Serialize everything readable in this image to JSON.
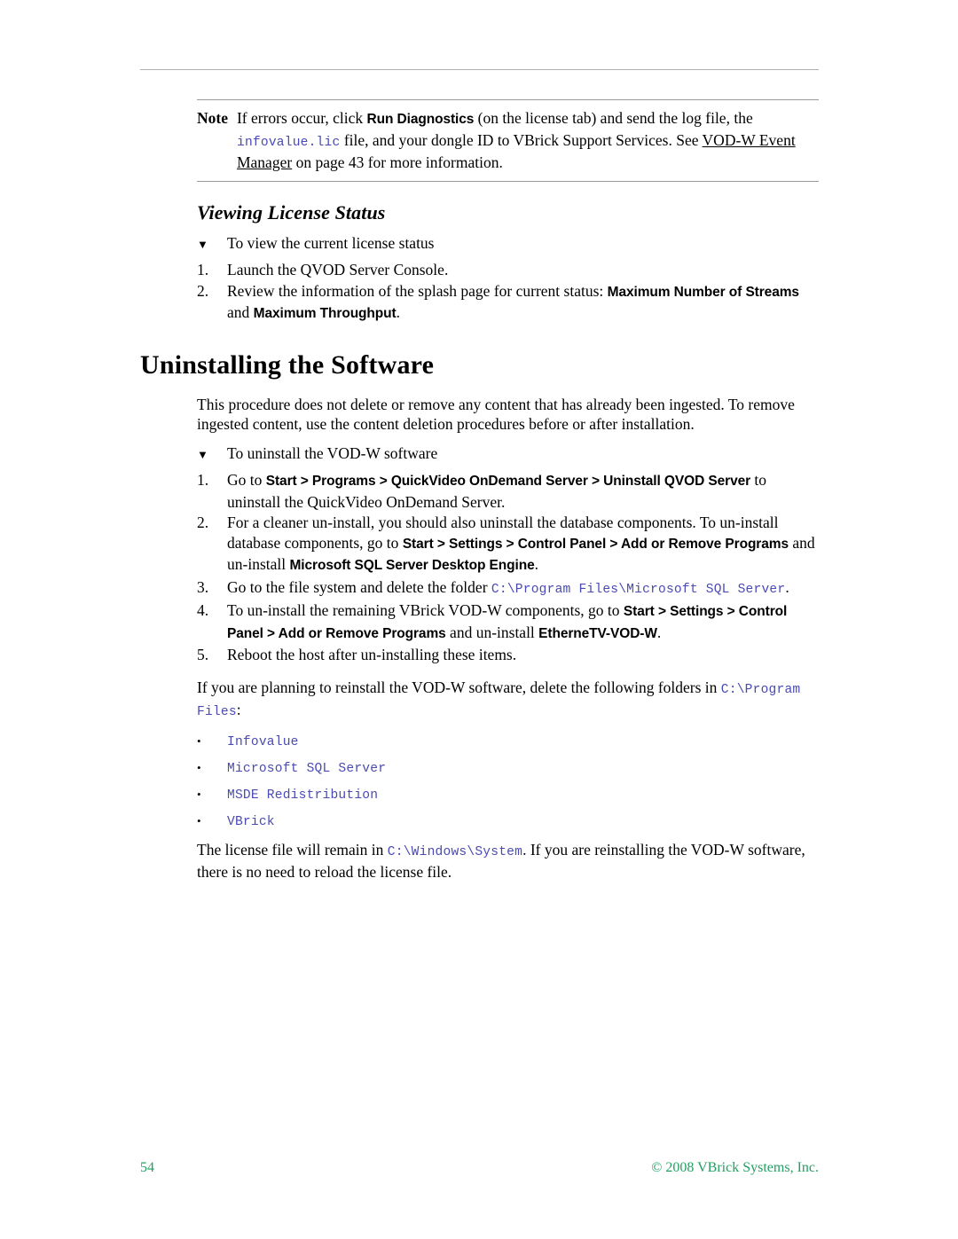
{
  "document": {
    "note": {
      "label": "Note",
      "text_1": "If errors occur, click ",
      "bold_1": "Run Diagnostics",
      "text_2": " (on the license tab) and send the log file, the ",
      "code_1": "infovalue.lic",
      "text_3": " file, and your dongle ID to VBrick Support Services. See ",
      "xref": "VOD-W Event Manager",
      "text_4": " on page 43 for more information."
    },
    "section_license": {
      "heading": "Viewing License Status",
      "procedure_title": "To view the current license status",
      "triangle_marker": "▼",
      "steps": [
        {
          "num": "1.",
          "text_1": "Launch the QVOD Server Console."
        },
        {
          "num": "2.",
          "text_1": "Review the information of the splash page for current status: ",
          "bold_1": "Maximum Number of Streams",
          "text_2": " and ",
          "bold_2": "Maximum Throughput",
          "text_3": "."
        }
      ]
    },
    "section_uninstall": {
      "heading": "Uninstalling the Software",
      "intro": "This procedure does not delete or remove any content that has already been ingested. To remove ingested content, use the content deletion procedures before or after installation.",
      "procedure_title": "To uninstall the VOD-W software",
      "triangle_marker": "▼",
      "steps": [
        {
          "num": "1.",
          "text_1": "Go to ",
          "bold_1": "Start > Programs > QuickVideo OnDemand Server > Uninstall QVOD Server",
          "text_2": " to uninstall the QuickVideo OnDemand Server."
        },
        {
          "num": "2.",
          "text_1": "For a cleaner un-install, you should also uninstall the database components. To un-install database components, go to ",
          "bold_1": "Start > Settings > Control Panel > Add or Remove Programs",
          "text_2": " and un-install ",
          "bold_2": "Microsoft SQL Server Desktop Engine",
          "text_3": "."
        },
        {
          "num": "3.",
          "text_1": "Go to the file system and delete the folder ",
          "code_1": "C:\\Program Files\\Microsoft SQL Server",
          "text_2": "."
        },
        {
          "num": "4.",
          "text_1": "To un-install the remaining VBrick VOD-W components, go to ",
          "bold_1": "Start > Settings > Control Panel > Add or Remove Programs",
          "text_2": " and un-install ",
          "bold_2": "EtherneTV-VOD-W",
          "text_3": "."
        },
        {
          "num": "5.",
          "text_1": "Reboot the host after un-installing these items."
        }
      ],
      "reinstall_para": {
        "text_1": "If you are planning to reinstall the VOD-W software, delete the following folders in ",
        "code_1": "C:\\Program Files",
        "text_2": ":"
      },
      "folder_bullet": "•",
      "folders": [
        "Infovalue",
        "Microsoft SQL Server",
        "MSDE Redistribution",
        "VBrick"
      ],
      "license_para": {
        "text_1": "The license file will remain in ",
        "code_1": "C:\\Windows\\System",
        "text_2": ". If you are reinstalling the VOD-W software, there is no need to reload the license file."
      }
    },
    "footer": {
      "page_number": "54",
      "copyright": "© 2008 VBrick Systems, Inc."
    },
    "colors": {
      "code_blue": "#4a4ab4",
      "footer_green": "#23a062",
      "rule_gray": "#9a9a9a",
      "header_rule_gray": "#b0b0b0"
    }
  }
}
